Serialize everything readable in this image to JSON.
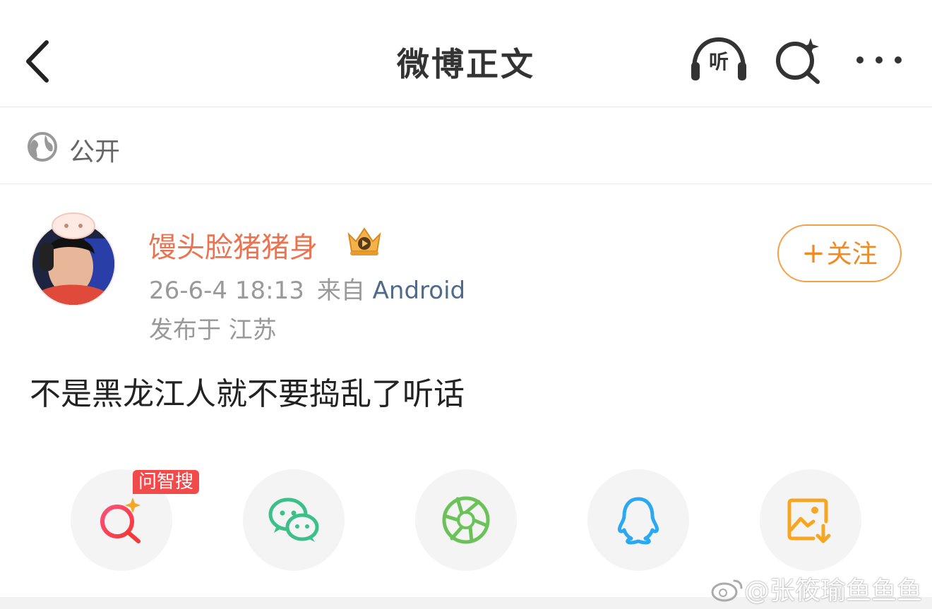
{
  "header": {
    "title": "微博正文",
    "listen_label": "听"
  },
  "visibility": {
    "label": "公开"
  },
  "post": {
    "username": "馒头脸猪猪身",
    "time": "26-6-4 18:13",
    "from_prefix": "来自",
    "client": "Android",
    "location": "发布于 江苏",
    "text": "不是黑龙江人就不要捣乱了听话",
    "follow_label": "关注",
    "follow_plus": "+"
  },
  "share": {
    "ai_badge": "问智搜",
    "items": [
      "ai-search-icon",
      "wechat-icon",
      "moments-icon",
      "qq-icon",
      "save-image-icon"
    ]
  },
  "watermark": "@张筱瑜鱼鱼鱼",
  "colors": {
    "username": "#eb7350",
    "follow": "#f08a21",
    "client_link": "#506a8c",
    "ai_badge": "#f24a4a",
    "wechat": "#3cc08a",
    "moments": "#6ac259",
    "qq": "#2aa8f2",
    "save": "#f5a623"
  }
}
